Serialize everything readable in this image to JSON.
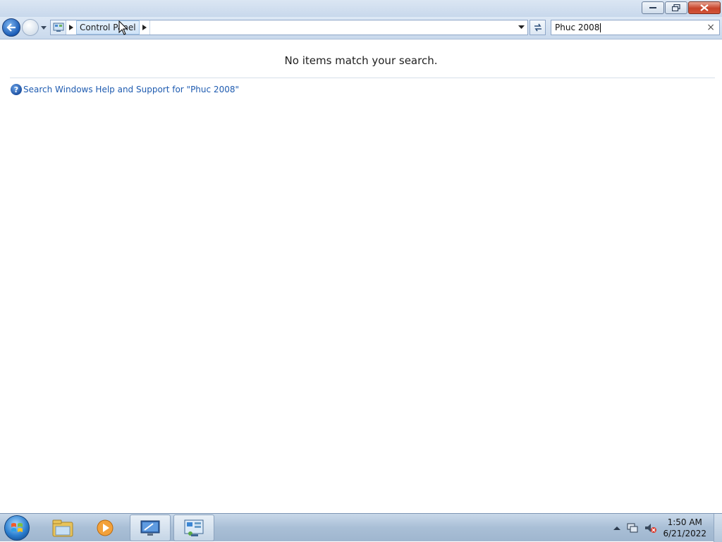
{
  "window": {
    "minimize_label": "Minimize",
    "restore_label": "Restore",
    "close_label": "Close"
  },
  "address_bar": {
    "breadcrumb": "Control Panel"
  },
  "search": {
    "value": "Phuc 2008",
    "clear_icon": "×"
  },
  "content": {
    "empty_message": "No items match your search.",
    "help_link": "Search Windows Help and Support for \"Phuc 2008\""
  },
  "taskbar": {
    "pinned": [
      "start-orb-icon",
      "windows-explorer-icon",
      "media-player-icon",
      "remote-desktop-icon",
      "control-panel-icon"
    ],
    "clock_time": "1:50 AM",
    "clock_date": "6/21/2022"
  },
  "colors": {
    "link": "#1e5bb0",
    "close_button": "#c7442a",
    "accent": "#1b5db8"
  }
}
